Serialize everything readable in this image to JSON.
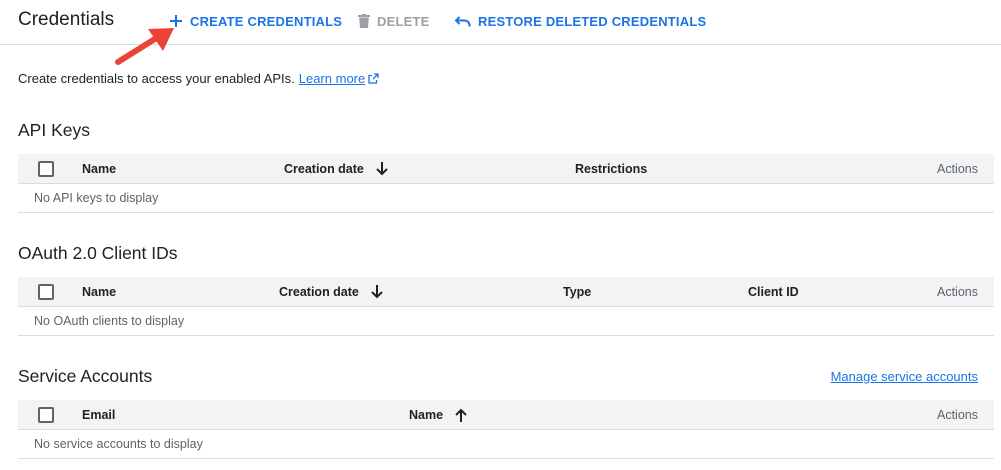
{
  "header": {
    "title": "Credentials",
    "actions": {
      "create": "CREATE CREDENTIALS",
      "delete": "DELETE",
      "restore": "RESTORE DELETED CREDENTIALS"
    }
  },
  "intro": {
    "text": "Create credentials to access your enabled APIs.",
    "link": "Learn more"
  },
  "api_keys": {
    "title": "API Keys",
    "columns": {
      "name": "Name",
      "creation_date": "Creation date",
      "restrictions": "Restrictions",
      "actions": "Actions"
    },
    "empty": "No API keys to display"
  },
  "oauth": {
    "title": "OAuth 2.0 Client IDs",
    "columns": {
      "name": "Name",
      "creation_date": "Creation date",
      "type": "Type",
      "client_id": "Client ID",
      "actions": "Actions"
    },
    "empty": "No OAuth clients to display"
  },
  "service_accounts": {
    "title": "Service Accounts",
    "manage_link": "Manage service accounts",
    "columns": {
      "email": "Email",
      "name": "Name",
      "actions": "Actions"
    },
    "empty": "No service accounts to display"
  },
  "colors": {
    "accent": "#1a73e8",
    "disabled": "#9aa0a6",
    "annotation_arrow": "#ea4335",
    "header_bg": "#f1f3f4",
    "divider": "#dadce0"
  },
  "icons": {
    "create": "plus-icon",
    "delete": "trash-icon",
    "restore": "undo-icon",
    "external": "external-link-icon",
    "sort_desc": "arrow-down-icon",
    "sort_asc": "arrow-up-icon",
    "annotation": "red-pointer-arrow"
  }
}
